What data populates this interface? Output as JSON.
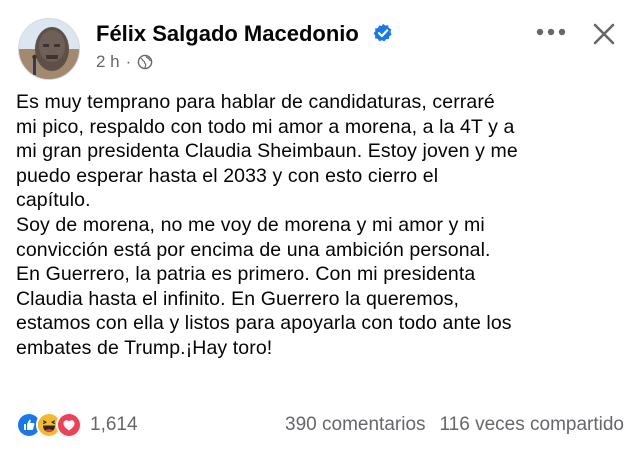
{
  "post": {
    "author_name": "Félix Salgado Macedonio",
    "time_ago": "2 h",
    "separator": "·",
    "audience_icon": "globe-icon",
    "verified_icon": "verified-badge-icon",
    "body": "Es muy temprano para hablar de candidaturas, cerraré\nmi pico, respaldo con todo mi amor a morena, a la 4T y a\nmi gran presidenta Claudia Sheimbaun. Estoy joven y me\npuedo esperar hasta el 2033 y con esto cierro el\ncapítulo.\n Soy de morena, no me voy de morena y mi amor y mi\nconvicción está por encima de una ambición personal.\nEn Guerrero, la patria es primero. Con mi presidenta\nClaudia hasta el infinito. En Guerrero la queremos,\nestamos con ella y listos para apoyarla con todo ante los\nembates de Trump.¡Hay toro!"
  },
  "footer": {
    "reaction_icons": [
      "like-icon",
      "haha-icon",
      "love-icon"
    ],
    "reaction_count": "1,614",
    "comments": "390 comentarios",
    "shares": "116 veces compartido"
  },
  "colors": {
    "text": "#050505",
    "secondary": "#65676b",
    "like_blue": "#1877f2",
    "love_red": "#f33e58",
    "haha_yellow": "#f7b928"
  }
}
